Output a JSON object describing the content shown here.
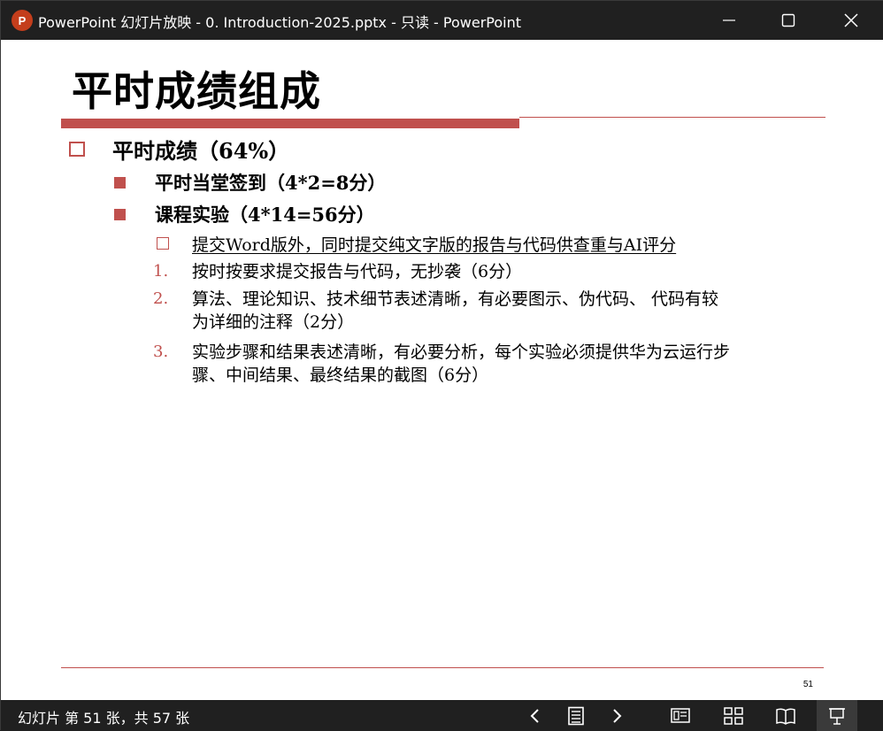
{
  "titlebar": {
    "app_icon_letter": "P",
    "title": "PowerPoint 幻灯片放映  -  0. Introduction-2025.pptx  -  只读 - PowerPoint"
  },
  "slide": {
    "title": "平时成绩组成",
    "level1": "平时成绩（64%）",
    "level2": [
      "平时当堂签到（4*2=8分）",
      "课程实验（4*14=56分）"
    ],
    "level3": "提交Word版外，同时提交纯文字版的报告与代码供查重与AI评分",
    "numbered": [
      {
        "num": "1.",
        "lines": [
          "按时按要求提交报告与代码，无抄袭（6分）"
        ]
      },
      {
        "num": "2.",
        "lines": [
          "算法、理论知识、技术细节表述清晰，有必要图示、伪代码、 代码有较",
          "为详细的注释（2分）"
        ]
      },
      {
        "num": "3.",
        "lines": [
          "实验步骤和结果表述清晰，有必要分析，每个实验必须提供华为云运行步",
          "骤、中间结果、最终结果的截图（6分）"
        ]
      }
    ],
    "page_number": "51"
  },
  "statusbar": {
    "text": "幻灯片 第 51 张，共 57 张",
    "buttons": [
      "previous-icon",
      "slide-list-icon",
      "next-icon",
      "normal-view-icon",
      "slide-sorter-icon",
      "reading-view-icon",
      "slideshow-icon"
    ]
  },
  "colors": {
    "accent": "#c0504d",
    "chrome": "#202020"
  }
}
